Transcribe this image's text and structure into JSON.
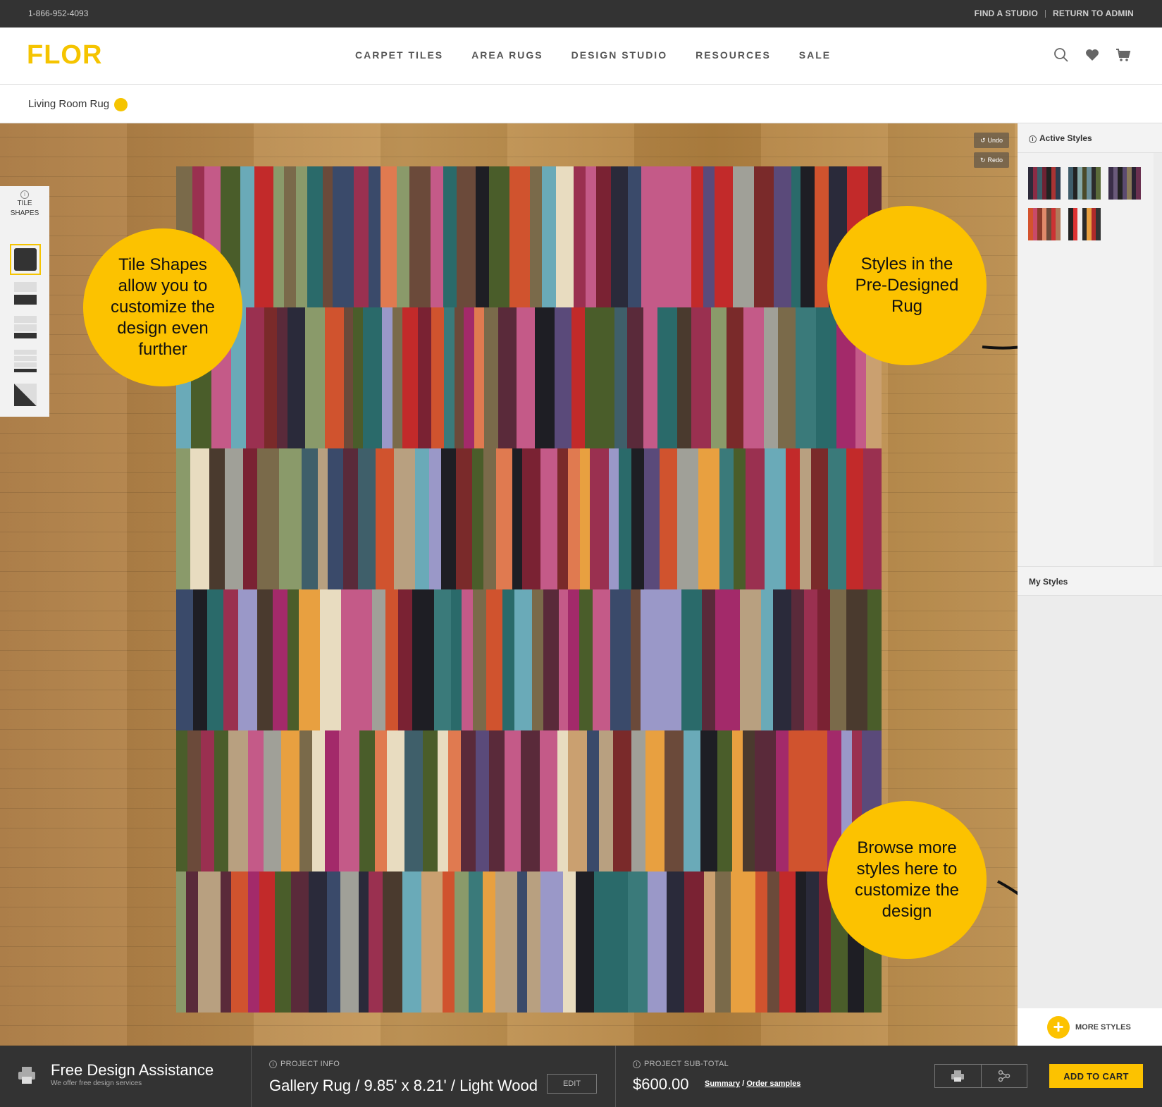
{
  "topbar": {
    "phone": "1-866-952-4093",
    "links": [
      "FIND A STUDIO",
      "RETURN TO ADMIN"
    ]
  },
  "header": {
    "logo": "FLOR",
    "nav": [
      "CARPET TILES",
      "AREA RUGS",
      "DESIGN STUDIO",
      "RESOURCES",
      "SALE"
    ],
    "icons": [
      "search-icon",
      "heart-icon",
      "cart-icon"
    ]
  },
  "project": {
    "name": "Living Room Rug",
    "dot_color": "#f5c400"
  },
  "canvas": {
    "undo": "Undo",
    "redo": "Redo"
  },
  "tile_shapes": {
    "title_line1": "TILE",
    "title_line2": "SHAPES",
    "info": "i"
  },
  "callouts": {
    "tile_shapes": "Tile Shapes allow you to customize the design even further",
    "styles": "Styles in the Pre-Designed Rug",
    "browse": "Browse more styles here to customize the design"
  },
  "panel": {
    "active_styles": "Active Styles",
    "my_styles": "My Styles",
    "more_styles": "MORE STYLES",
    "info": "i"
  },
  "footer": {
    "fda_title": "Free Design Assistance",
    "fda_sub": "We offer free design services",
    "project_info_label": "PROJECT INFO",
    "project_info_value": "Gallery Rug / 9.85' x 8.21' / Light Wood",
    "edit": "EDIT",
    "subtotal_label": "PROJECT SUB-TOTAL",
    "subtotal_value": "$600.00",
    "summary": "Summary",
    "slash": "/",
    "order_samples": "Order samples",
    "add_to_cart": "ADD TO CART",
    "info": "i"
  },
  "colors": {
    "accent": "#fcc200",
    "dark": "#333333"
  }
}
